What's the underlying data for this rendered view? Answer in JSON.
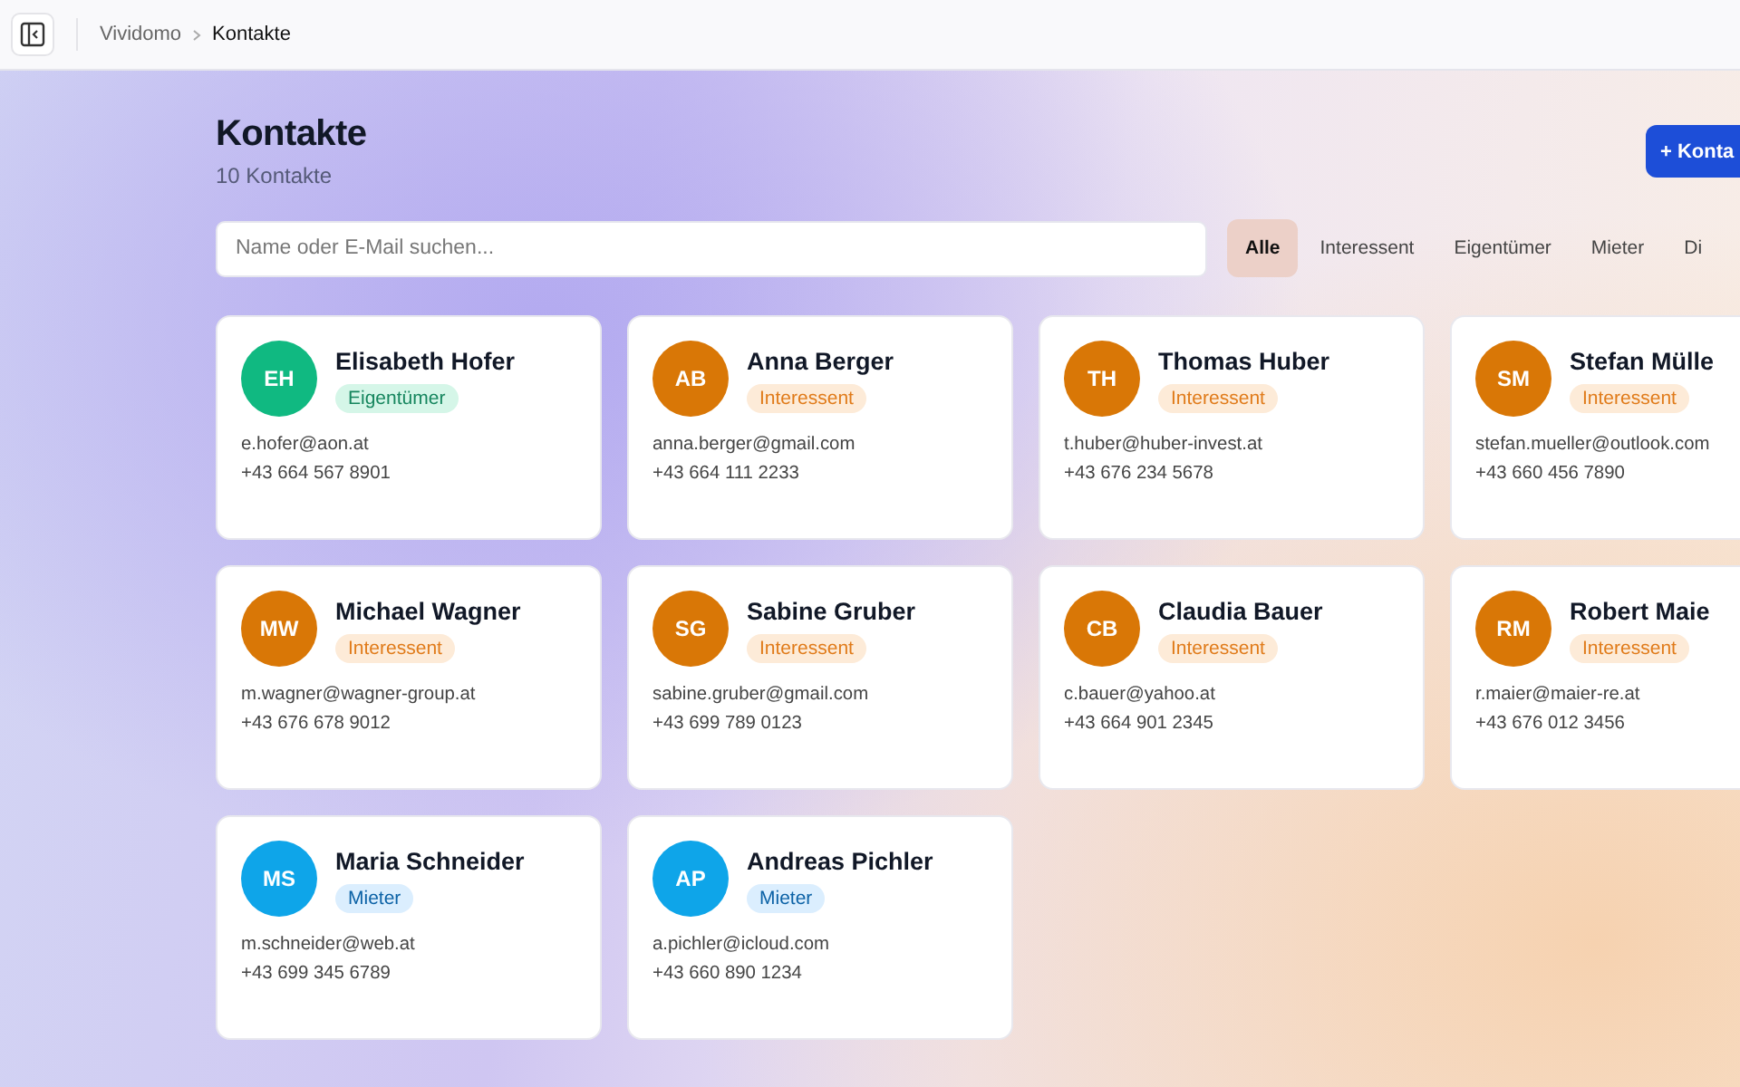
{
  "topbar": {
    "breadcrumb": [
      "Vividomo",
      "Kontakte"
    ]
  },
  "header": {
    "title": "Kontakte",
    "subtitle": "10 Kontakte",
    "add_button": "+ Konta"
  },
  "search": {
    "placeholder": "Name oder E-Mail suchen..."
  },
  "filters": [
    {
      "label": "Alle",
      "selected": true
    },
    {
      "label": "Interessent",
      "selected": false
    },
    {
      "label": "Eigentümer",
      "selected": false
    },
    {
      "label": "Mieter",
      "selected": false
    },
    {
      "label": "Di",
      "selected": false
    }
  ],
  "contacts": [
    {
      "initials": "EH",
      "name": "Elisabeth Hofer",
      "role": "Eigentümer",
      "kind": "owner",
      "email": "e.hofer@aon.at",
      "phone": "+43 664 567 8901"
    },
    {
      "initials": "AB",
      "name": "Anna Berger",
      "role": "Interessent",
      "kind": "prospect",
      "email": "anna.berger@gmail.com",
      "phone": "+43 664 111 2233"
    },
    {
      "initials": "TH",
      "name": "Thomas Huber",
      "role": "Interessent",
      "kind": "prospect",
      "email": "t.huber@huber-invest.at",
      "phone": "+43 676 234 5678"
    },
    {
      "initials": "SM",
      "name": "Stefan Mülle",
      "role": "Interessent",
      "kind": "prospect",
      "email": "stefan.mueller@outlook.com",
      "phone": "+43 660 456 7890"
    },
    {
      "initials": "MW",
      "name": "Michael Wagner",
      "role": "Interessent",
      "kind": "prospect",
      "email": "m.wagner@wagner-group.at",
      "phone": "+43 676 678 9012"
    },
    {
      "initials": "SG",
      "name": "Sabine Gruber",
      "role": "Interessent",
      "kind": "prospect",
      "email": "sabine.gruber@gmail.com",
      "phone": "+43 699 789 0123"
    },
    {
      "initials": "CB",
      "name": "Claudia Bauer",
      "role": "Interessent",
      "kind": "prospect",
      "email": "c.bauer@yahoo.at",
      "phone": "+43 664 901 2345"
    },
    {
      "initials": "RM",
      "name": "Robert Maie",
      "role": "Interessent",
      "kind": "prospect",
      "email": "r.maier@maier-re.at",
      "phone": "+43 676 012 3456"
    },
    {
      "initials": "MS",
      "name": "Maria Schneider",
      "role": "Mieter",
      "kind": "tenant",
      "email": "m.schneider@web.at",
      "phone": "+43 699 345 6789"
    },
    {
      "initials": "AP",
      "name": "Andreas Pichler",
      "role": "Mieter",
      "kind": "tenant",
      "email": "a.pichler@icloud.com",
      "phone": "+43 660 890 1234"
    }
  ]
}
